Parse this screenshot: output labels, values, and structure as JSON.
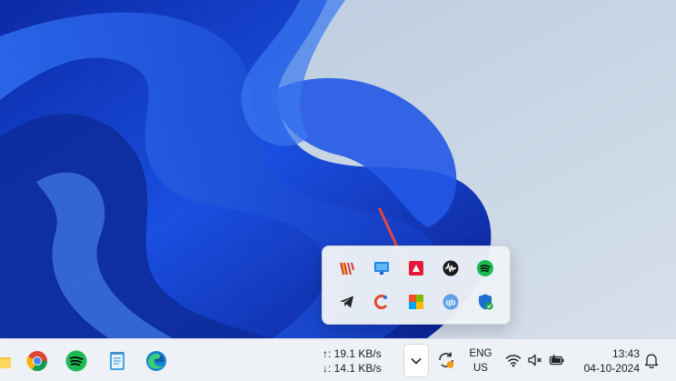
{
  "wallpaper": {
    "primary": "#1846d8",
    "deep": "#0a1f8f",
    "light": "#4f8cf2",
    "sky": "#c7d5e4"
  },
  "tray_flyout": {
    "icons": [
      {
        "name": "winstep-icon"
      },
      {
        "name": "display-monitor-icon"
      },
      {
        "name": "amd-software-icon"
      },
      {
        "name": "audio-wave-icon"
      },
      {
        "name": "spotify-tray-icon"
      },
      {
        "name": "telegram-icon"
      },
      {
        "name": "ccleaner-icon"
      },
      {
        "name": "microsoft-store-app-icon"
      },
      {
        "name": "qbittorrent-icon"
      },
      {
        "name": "windows-security-icon"
      }
    ]
  },
  "taskbar": {
    "apps": [
      {
        "name": "file-explorer-icon"
      },
      {
        "name": "chrome-icon"
      },
      {
        "name": "spotify-icon"
      },
      {
        "name": "notepad-icon"
      },
      {
        "name": "edge-icon"
      }
    ],
    "network": {
      "upload": "↑: 19.1 KB/s",
      "download": "↓: 14.1 KB/s"
    },
    "language": {
      "line1": "ENG",
      "line2": "US"
    },
    "clock": {
      "time": "13:43",
      "date": "04-10-2024"
    }
  },
  "annotation": {
    "arrow_color": "#e5473b"
  }
}
